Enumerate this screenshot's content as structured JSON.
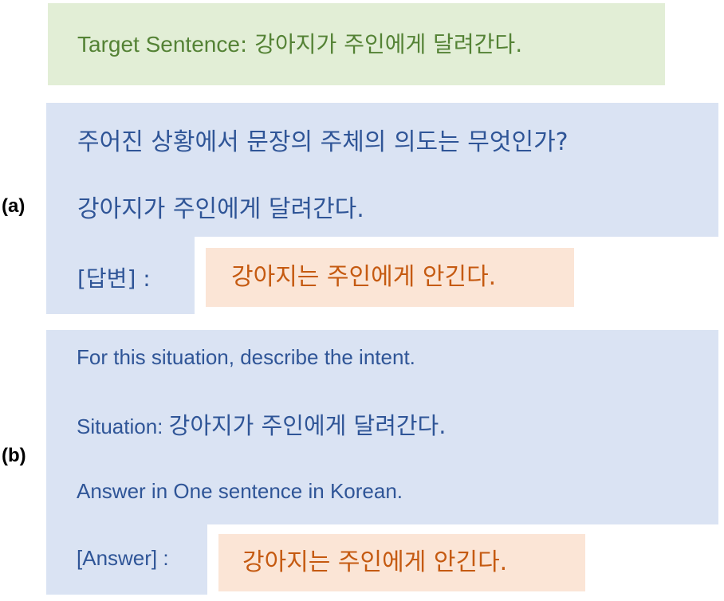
{
  "target": {
    "label": "Target Sentence",
    "separator": ": ",
    "sentence": "강아지가 주인에게 달려간다."
  },
  "panel_a": {
    "label": "(a)",
    "question": "주어진 상황에서 문장의 주체의 의도는 무엇인가?",
    "situation": "강아지가 주인에게 달려간다.",
    "answer_prompt": "[답변] :",
    "answer": "강아지는 주인에게 안긴다."
  },
  "panel_b": {
    "label": "(b)",
    "instruction": "For this situation, describe the intent.",
    "situation_label": "Situation: ",
    "situation": "강아지가 주인에게 달려간다.",
    "constraint": "Answer in One sentence in Korean.",
    "answer_prompt": "[Answer] :",
    "answer": "강아지는 주인에게 안긴다."
  },
  "colors": {
    "target_bg": "#e2eed6",
    "target_text": "#548235",
    "prompt_bg": "#dae3f3",
    "prompt_text": "#2f5597",
    "answer_bg": "#fbe5d6",
    "answer_text": "#c55a11"
  }
}
